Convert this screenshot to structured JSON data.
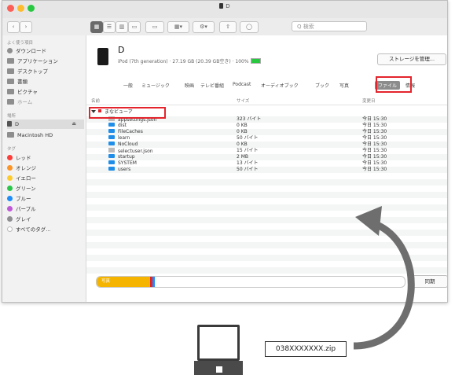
{
  "window": {
    "title": "D"
  },
  "toolbar": {
    "search_placeholder": "Q 検索"
  },
  "sidebar": {
    "sections": [
      {
        "header": "よく使う項目"
      },
      {
        "header": "場所"
      },
      {
        "header": "タグ"
      }
    ],
    "favorites": [
      {
        "label": "ダウンロード",
        "icon": "download-icon"
      },
      {
        "label": "アプリケーション",
        "icon": "apps-icon"
      },
      {
        "label": "デスクトップ",
        "icon": "desktop-icon"
      },
      {
        "label": "書類",
        "icon": "documents-icon"
      },
      {
        "label": "ピクチャ",
        "icon": "pictures-icon"
      },
      {
        "label": "ホーム",
        "icon": "home-icon"
      }
    ],
    "locations": [
      {
        "label": "D",
        "icon": "ipod-icon",
        "eject": "⏏"
      },
      {
        "label": "Macintosh HD",
        "icon": "disk-icon"
      }
    ],
    "tags": [
      {
        "label": "レッド",
        "color": "#fc3d39"
      },
      {
        "label": "オレンジ",
        "color": "#fd9426"
      },
      {
        "label": "イエロー",
        "color": "#fecb2e"
      },
      {
        "label": "グリーン",
        "color": "#29c649"
      },
      {
        "label": "ブルー",
        "color": "#1c8df9"
      },
      {
        "label": "パープル",
        "color": "#bf58d6"
      },
      {
        "label": "グレイ",
        "color": "#8e8e93"
      },
      {
        "label": "すべてのタグ…",
        "color": "#cccccc"
      }
    ]
  },
  "device": {
    "name": "D",
    "info": "iPod (7th generation) · 27.19 GB (20.39 GB空き) · 100%",
    "manage_button": "ストレージを管理..."
  },
  "tabs": [
    "一般",
    "ミュージック",
    "映画",
    "テレビ番組",
    "Podcast",
    "オーディオブック",
    "ブック",
    "写真",
    "ファイル",
    "情報"
  ],
  "active_tab": "ファイル",
  "table": {
    "columns": [
      "名前",
      "サイズ",
      "変更日"
    ],
    "group": {
      "name": "まなビューア"
    },
    "rows": [
      {
        "name": "appsettings.json",
        "size": "323 バイト",
        "date": "今日 15:30",
        "type": "json"
      },
      {
        "name": "dist",
        "size": "0 KB",
        "date": "今日 15:30",
        "type": "folder"
      },
      {
        "name": "FileCaches",
        "size": "0 KB",
        "date": "今日 15:30",
        "type": "folder"
      },
      {
        "name": "learn",
        "size": "50 バイト",
        "date": "今日 15:30",
        "type": "folder"
      },
      {
        "name": "NoCloud",
        "size": "0 KB",
        "date": "今日 15:30",
        "type": "folder"
      },
      {
        "name": "selectuser.json",
        "size": "15 バイト",
        "date": "今日 15:30",
        "type": "json"
      },
      {
        "name": "startup",
        "size": "2 MB",
        "date": "今日 15:30",
        "type": "folder"
      },
      {
        "name": "SYSTEM",
        "size": "13 バイト",
        "date": "今日 15:30",
        "type": "folder"
      },
      {
        "name": "users",
        "size": "50 バイト",
        "date": "今日 15:30",
        "type": "folder"
      }
    ]
  },
  "storage": {
    "label": "写真",
    "sync_button": "同期"
  },
  "overlay": {
    "zip_filename": "038XXXXXXX.zip"
  }
}
